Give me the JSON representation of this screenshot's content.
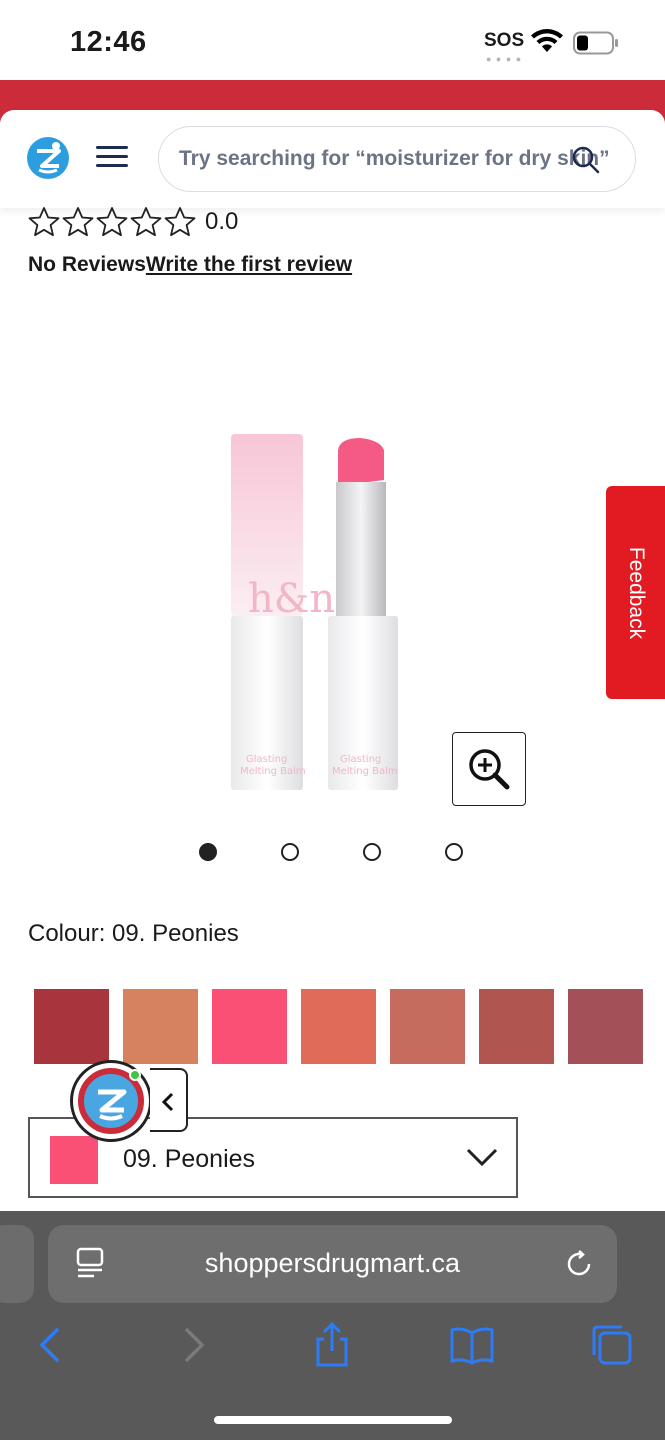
{
  "status_bar": {
    "time": "12:46",
    "carrier": "SOS",
    "icons": [
      "wifi-icon",
      "battery-icon"
    ]
  },
  "header": {
    "logo": "shoppers-drug-mart-logo",
    "menu_icon": "hamburger-icon",
    "search": {
      "placeholder": "Try searching for “moisturizer for dry skin”",
      "icon": "search-icon"
    }
  },
  "rating": {
    "stars_filled": 0,
    "stars_total": 5,
    "value": "0.0",
    "reviews_label": "No Reviews",
    "write_review_label": "Write the first review"
  },
  "gallery": {
    "image_count": 4,
    "active_index": 0,
    "product_brand_mark": "h&n",
    "product_label": "Glasting Melting Balm",
    "zoom_icon": "zoom-in-icon"
  },
  "feedback_tab": {
    "label": "Feedback"
  },
  "colour": {
    "label": "Colour: 09. Peonies",
    "swatches": [
      "#a8353d",
      "#d6825f",
      "#fb5075",
      "#df6b58",
      "#c56c5f",
      "#b05550",
      "#a45058"
    ],
    "selected_value": "09. Peonies",
    "selected_color": "#fb5075"
  },
  "chat_widget": {
    "avatar": "pharmacist-avatar",
    "collapse_icon": "chevron-left-icon"
  },
  "safari": {
    "url": "shoppersdrugmart.ca",
    "toolbar": [
      "back-icon",
      "forward-icon",
      "share-icon",
      "bookmarks-icon",
      "tabs-icon"
    ]
  },
  "colors": {
    "brand_red": "#cc2b3a",
    "feedback_red": "#e21b23",
    "safari_blue": "#2d7cf6"
  }
}
